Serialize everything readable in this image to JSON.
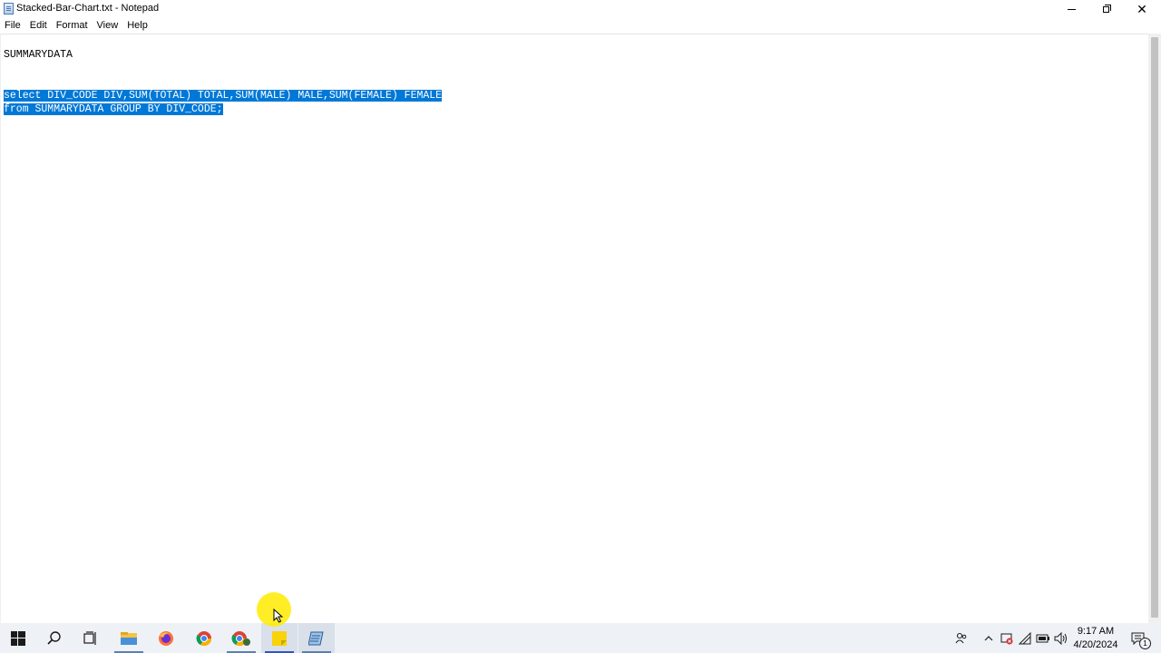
{
  "window": {
    "title": "Stacked-Bar-Chart.txt - Notepad",
    "app_icon": "notepad-icon",
    "controls": {
      "minimize_icon": "minimize-icon",
      "maximize_icon": "restore-icon",
      "close_icon": "close-icon"
    }
  },
  "menu": {
    "items": [
      "File",
      "Edit",
      "Format",
      "View",
      "Help"
    ]
  },
  "editor": {
    "lines": [
      "SUMMARYDATA",
      "",
      "",
      "select DIV_CODE DIV,SUM(TOTAL) TOTAL,SUM(MALE) MALE,SUM(FEMALE) FEMALE",
      "from SUMMARYDATA GROUP BY DIV_CODE;"
    ],
    "selected_lines": [
      3,
      4
    ],
    "selection_color": "#0078d7"
  },
  "taskbar": {
    "start_icon": "windows-start-icon",
    "items": [
      {
        "name": "search-icon"
      },
      {
        "name": "task-view-icon"
      },
      {
        "name": "file-explorer-icon"
      },
      {
        "name": "firefox-icon"
      },
      {
        "name": "chrome-icon"
      },
      {
        "name": "chrome-profile-icon"
      },
      {
        "name": "sticky-notes-icon"
      },
      {
        "name": "notepad-icon"
      }
    ],
    "tray": {
      "icons": [
        "people-icon",
        "chevron-up-icon",
        "defender-icon",
        "network-icon",
        "battery-icon",
        "volume-icon"
      ],
      "time": "9:17 AM",
      "date": "4/20/2024",
      "notification_icon": "notification-icon",
      "notification_count": "1"
    }
  }
}
